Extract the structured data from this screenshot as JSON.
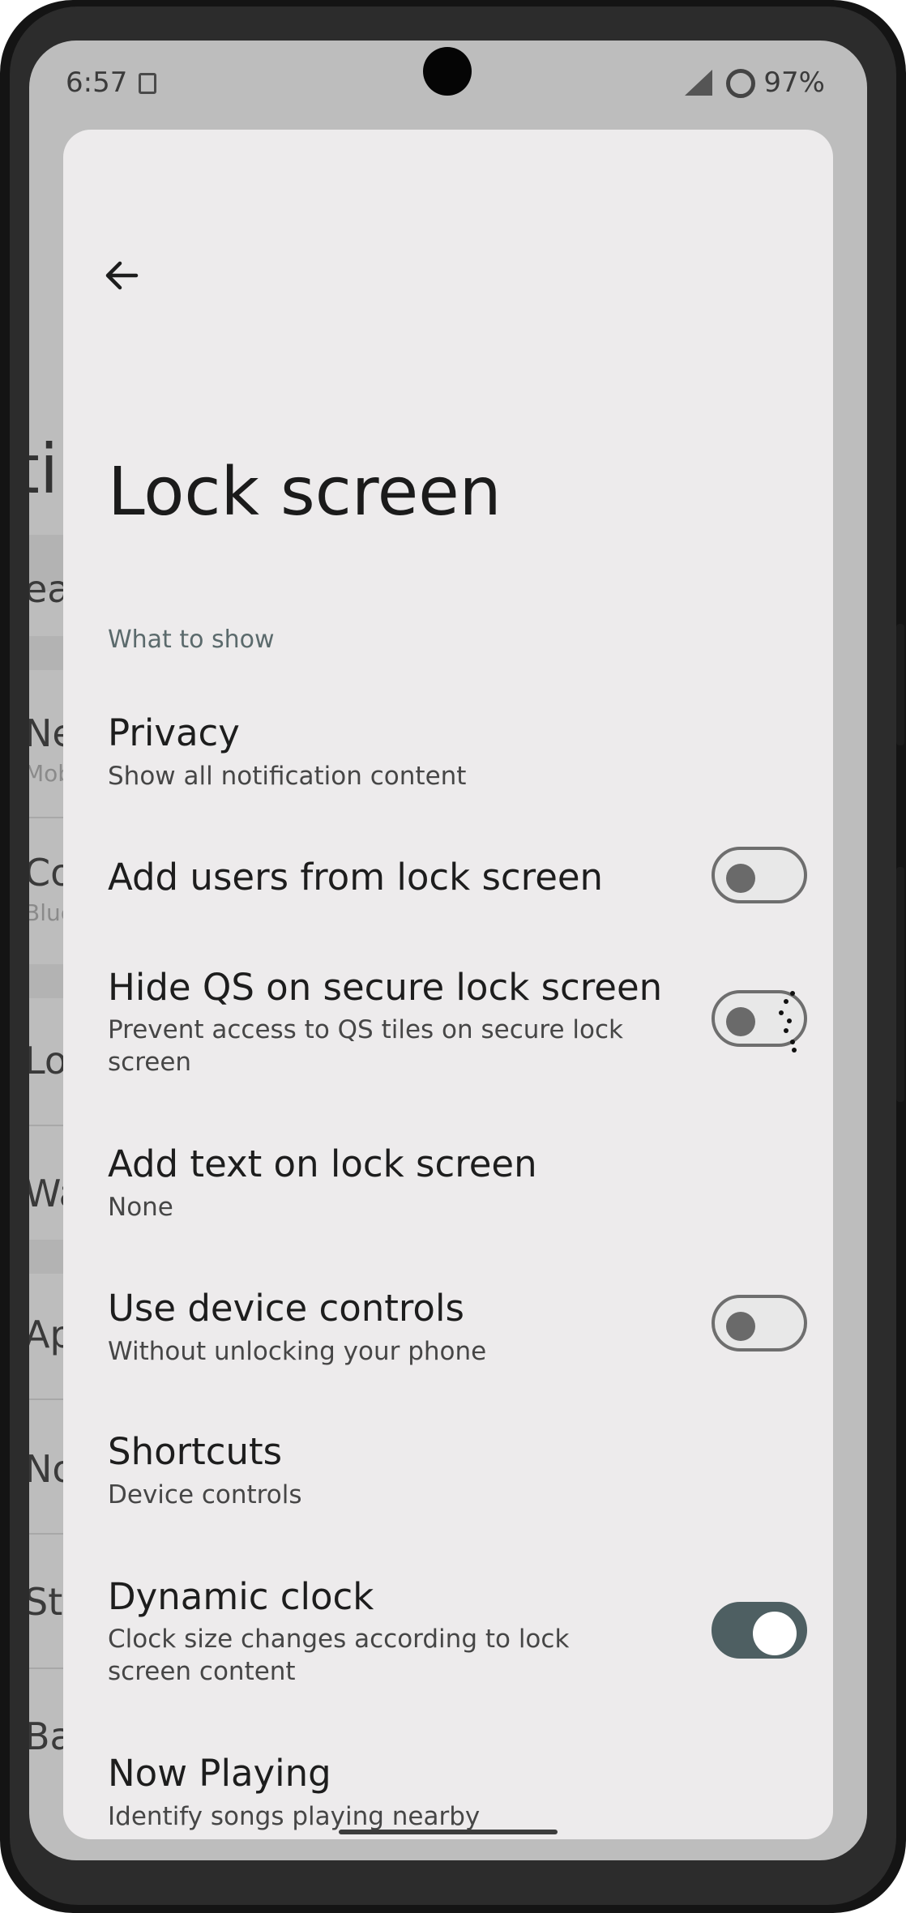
{
  "status_bar": {
    "time": "6:57",
    "battery": "97%"
  },
  "background_list": {
    "title_fragment": "ti",
    "items": [
      "ear",
      "Ne",
      "Mob",
      "Co",
      "Blue",
      "Loc",
      "Wa",
      "Ap",
      "No",
      "Sto",
      "Bat"
    ]
  },
  "page": {
    "title": "Lock screen",
    "section_header": "What to show"
  },
  "settings": [
    {
      "title": "Privacy",
      "subtitle": "Show all notification content"
    },
    {
      "title": "Add users from lock screen",
      "subtitle": "",
      "toggle": false
    },
    {
      "title": "Hide QS on secure lock screen",
      "subtitle": "Prevent access to QS tiles on secure lock screen",
      "toggle": false
    },
    {
      "title": "Add text on lock screen",
      "subtitle": "None"
    },
    {
      "title": "Use device controls",
      "subtitle": "Without unlocking your phone",
      "toggle": false
    },
    {
      "title": "Shortcuts",
      "subtitle": "Device controls"
    },
    {
      "title": "Dynamic clock",
      "subtitle": "Clock size changes according to lock screen content",
      "toggle": true
    },
    {
      "title": "Now Playing",
      "subtitle": "Identify songs playing nearby"
    }
  ],
  "colors": {
    "sheet": "#edebec",
    "toggle_on": "#4e5f62",
    "section_header": "#5b6a6c"
  }
}
